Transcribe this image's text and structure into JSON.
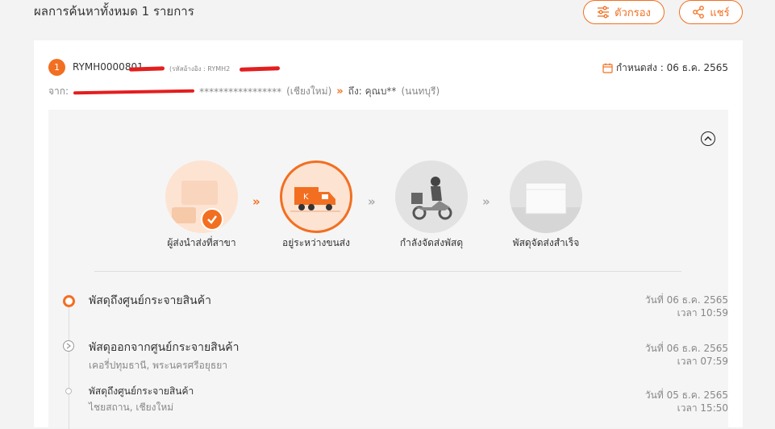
{
  "header": {
    "title": "ผลการค้นหาทั้งหมด 1 รายการ"
  },
  "actions": {
    "filter_label": "ตัวกรอง",
    "share_label": "แชร์"
  },
  "order": {
    "index": "1",
    "tracking": "RYMH0000801",
    "ref_label": "(รหัสอ้างอิง : RYMH2",
    "due_label": "กำหนดส่ง : 06 ธ.ค. 2565",
    "from_prefix": "จาก:",
    "from_masked": "*****************",
    "from_city": "(เชียงใหม่)",
    "to_label": "ถึง: คุณบ**",
    "to_city": "(นนทบุรี)"
  },
  "steps": [
    {
      "label": "ผู้ส่งนำส่งที่สาขา",
      "state": "done"
    },
    {
      "label": "อยู่ระหว่างขนส่ง",
      "state": "current"
    },
    {
      "label": "กำลังจัดส่งพัสดุ",
      "state": "pending"
    },
    {
      "label": "พัสดุจัดส่งสำเร็จ",
      "state": "pending"
    }
  ],
  "events": [
    {
      "title": "พัสดุถึงศูนย์กระจายสินค้า",
      "location": "",
      "date": "วันที่ 06 ธ.ค. 2565",
      "time": "เวลา 10:59"
    },
    {
      "title": "พัสดุออกจากศูนย์กระจายสินค้า",
      "location": "เคอรี่ปทุมธานี, พระนครศรีอยุธยา",
      "date": "วันที่ 06 ธ.ค. 2565",
      "time": "เวลา 07:59"
    },
    {
      "title": "พัสดุถึงศูนย์กระจายสินค้า",
      "location": "ไชยสถาน, เชียงใหม่",
      "date": "วันที่ 05 ธ.ค. 2565",
      "time": "เวลา 15:50"
    }
  ],
  "colors": {
    "accent": "#f26f21",
    "bg": "#f3f3f3"
  }
}
